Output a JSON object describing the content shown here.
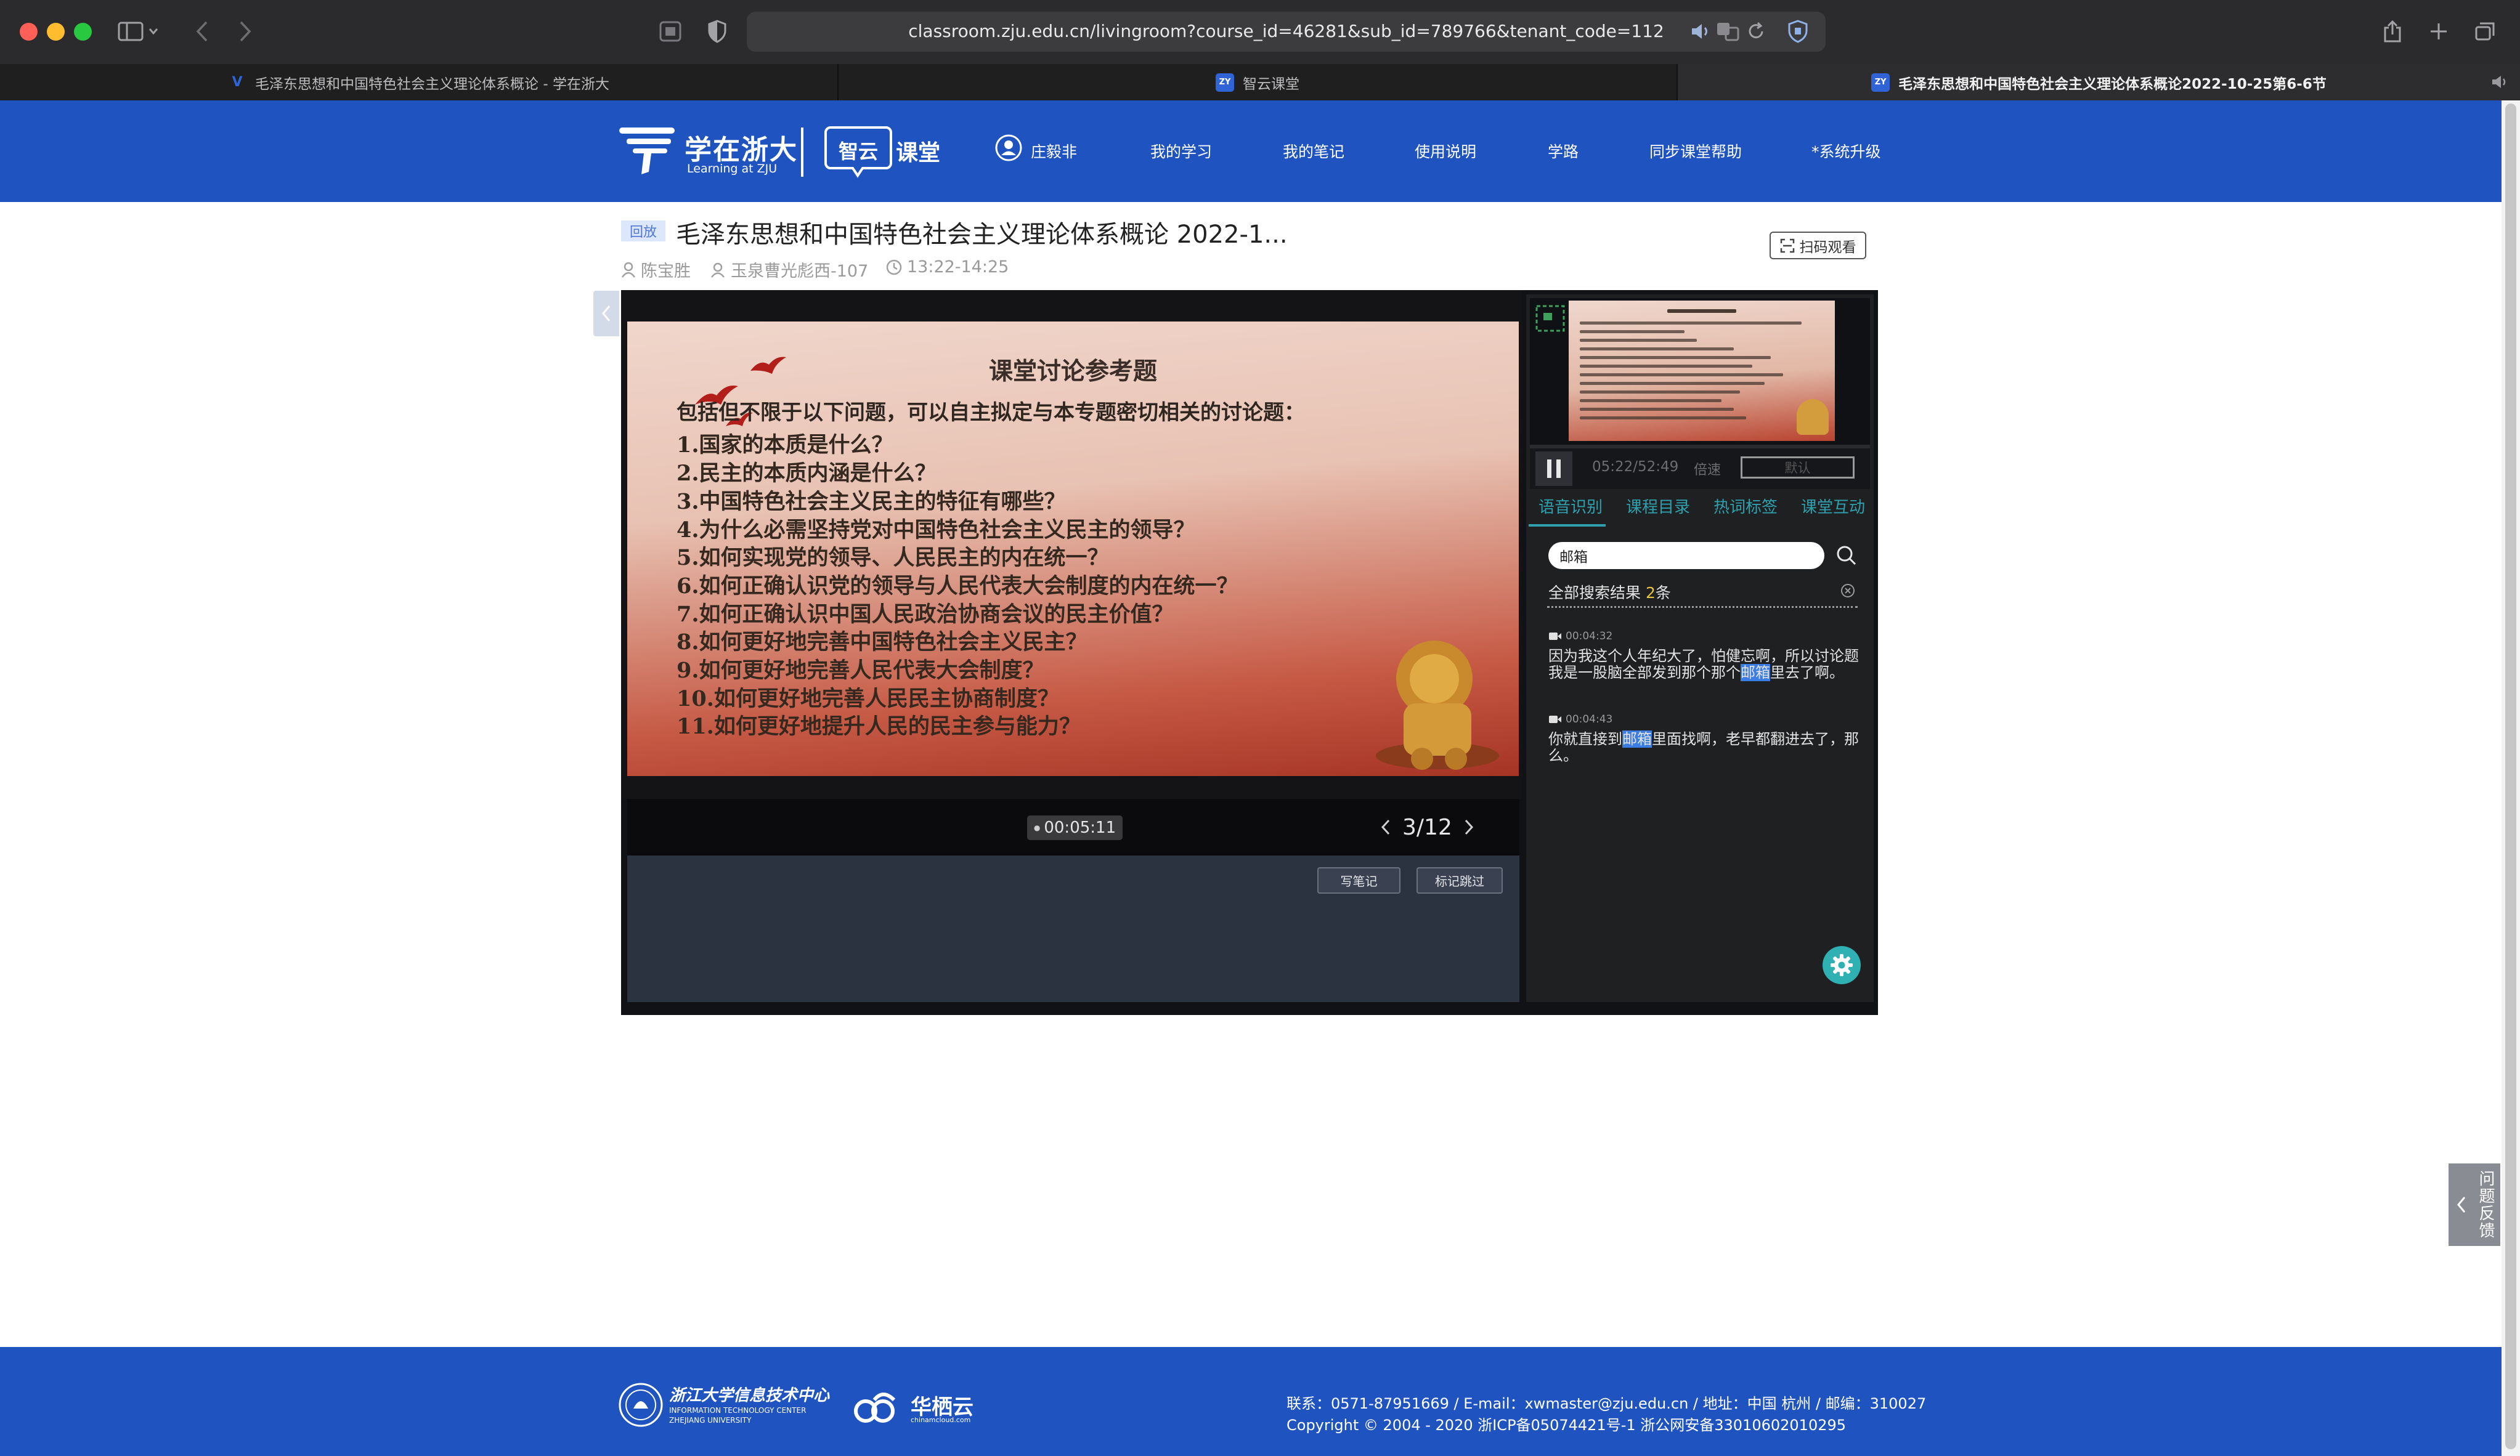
{
  "browser": {
    "url": "classroom.zju.edu.cn/livingroom?course_id=46281&sub_id=789766&tenant_code=112",
    "tabs": [
      {
        "title": "毛泽东思想和中国特色社会主义理论体系概论 - 学在浙大",
        "favicon": "V"
      },
      {
        "title": "智云课堂",
        "favicon": "ZY"
      },
      {
        "title": "毛泽东思想和中国特色社会主义理论体系概论2022-10-25第6-6节",
        "favicon": "ZY"
      }
    ]
  },
  "header": {
    "logo_main": "学在浙大",
    "logo_sub": "Learning at ZJU",
    "brand_badge": "智云",
    "brand_suffix": "课堂",
    "user_name": "庄毅非",
    "nav": [
      "我的学习",
      "我的笔记",
      "使用说明",
      "学路",
      "同步课堂帮助",
      "*系统升级"
    ]
  },
  "course": {
    "badge": "回放",
    "title": "毛泽东思想和中国特色社会主义理论体系概论 2022-1...",
    "teacher": "陈宝胜",
    "room": "玉泉曹光彪西-107",
    "time": "13:22-14:25",
    "qr_label": "扫码观看"
  },
  "slide": {
    "title": "课堂讨论参考题",
    "intro": "包括但不限于以下问题，可以自主拟定与本专题密切相关的讨论题：",
    "questions": [
      "1.国家的本质是什么？",
      "2.民主的本质内涵是什么？",
      "3.中国特色社会主义民主的特征有哪些？",
      "4.为什么必需坚持党对中国特色社会主义民主的领导？",
      "5.如何实现党的领导、人民民主的内在统一？",
      "6.如何正确认识党的领导与人民代表大会制度的内在统一？",
      "7.如何正确认识中国人民政治协商会议的民主价值？",
      "8.如何更好地完善中国特色社会主义民主？",
      "9.如何更好地完善人民代表大会制度？",
      "10.如何更好地完善人民民主协商制度？",
      "11.如何更好地提升人民的民主参与能力？"
    ]
  },
  "player": {
    "slide_time": "00:05:11",
    "page": "3/12",
    "note_btn": "写笔记",
    "skip_btn": "标记跳过",
    "progress_time": "05:22/52:49",
    "speed_label": "倍速",
    "default_label": "默认"
  },
  "panel": {
    "tabs": [
      "语音识别",
      "课程目录",
      "热词标签",
      "课堂互动"
    ],
    "search_value": "邮箱",
    "results_prefix": "全部搜索结果 ",
    "results_count": "2",
    "results_suffix": "条",
    "results": [
      {
        "time": "00:04:32",
        "before": "因为我这个人年纪大了，怕健忘啊，所以讨论题我是一股脑全部发到那个那个",
        "hit": "邮箱",
        "after": "里去了啊。"
      },
      {
        "time": "00:04:43",
        "before": "你就直接到",
        "hit": "邮箱",
        "after": "里面找啊，老早都翻进去了，那么。"
      }
    ]
  },
  "feedback_label": "问题反馈",
  "footer": {
    "org_cn": "浙江大学信息技术中心",
    "org_en": "INFORMATION TECHNOLOGY CENTER",
    "org_en2": "ZHEJIANG UNIVERSITY",
    "partner": "华栖云",
    "partner_sub": "chinamcloud.com",
    "contact": "联系：0571-87951669 / E-mail：xwmaster@zju.edu.cn / 地址：中国 杭州 / 邮编：310027",
    "copyright": "Copyright © 2004 - 2020 浙ICP备05074421号-1 浙公网安备33010602010295"
  },
  "colors": {
    "brand_blue": "#1f54c0",
    "accent_teal": "#2ea0ae",
    "highlight": "#3b7de2",
    "count_yellow": "#e8c440"
  }
}
